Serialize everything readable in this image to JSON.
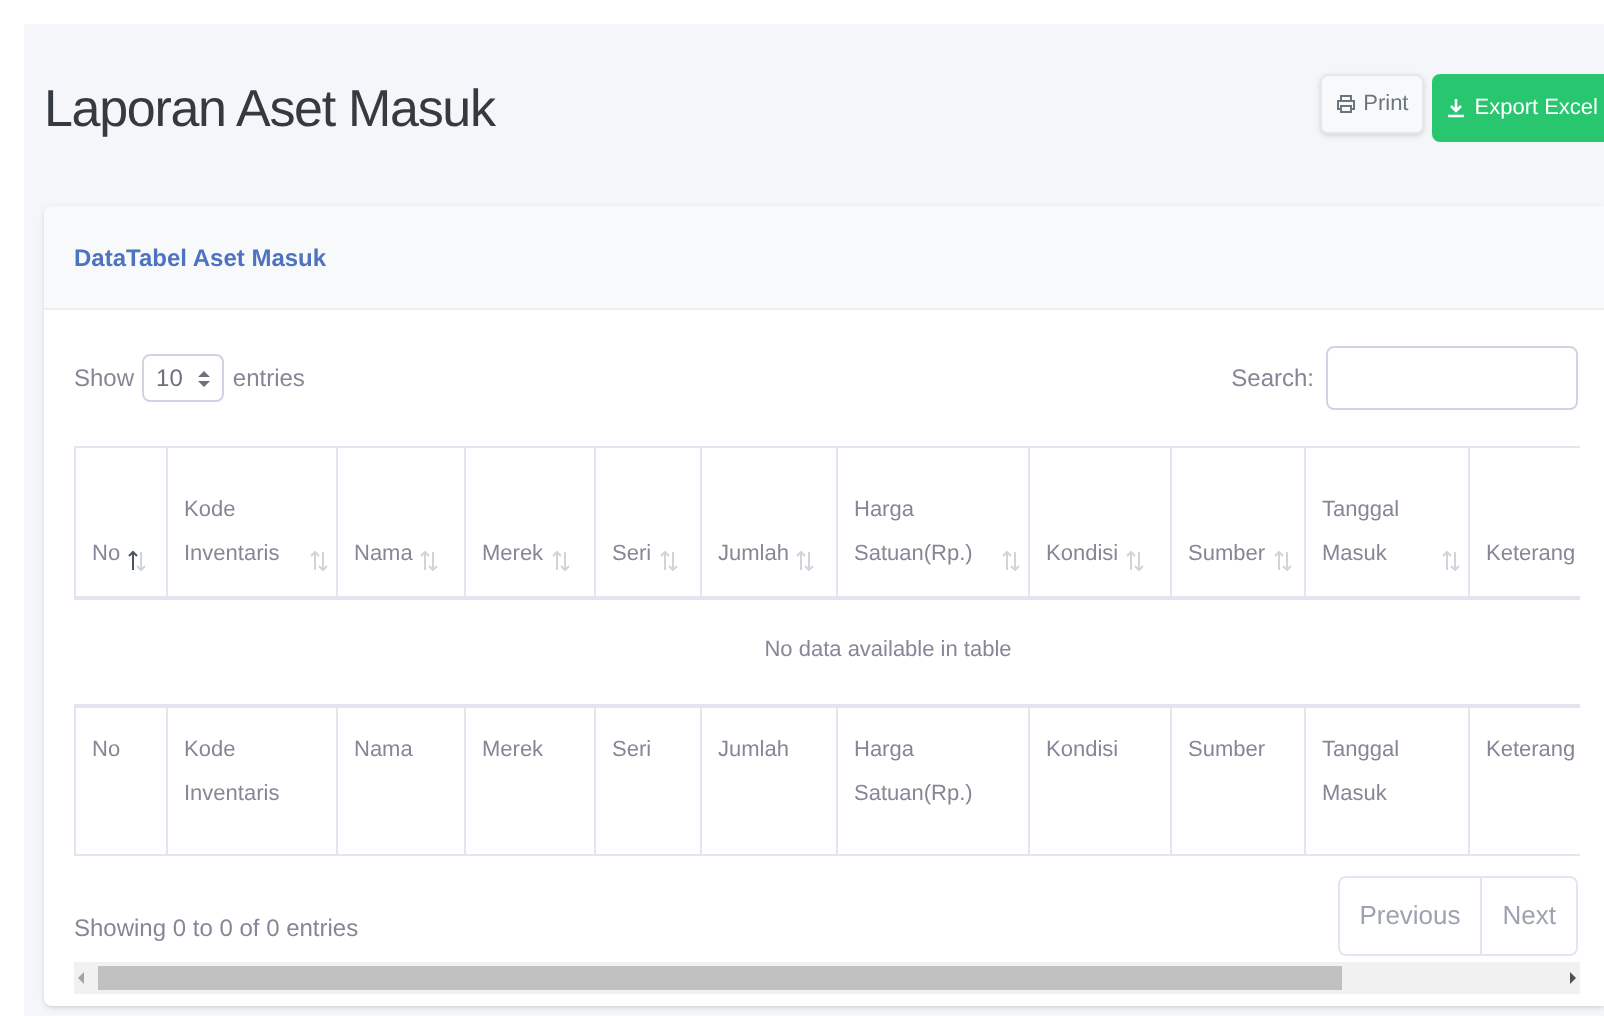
{
  "page": {
    "title": "Laporan Aset Masuk"
  },
  "actions": [
    {
      "kind": "print",
      "label": "Print"
    },
    {
      "kind": "export",
      "label": "Export Excel"
    }
  ],
  "card": {
    "title": "DataTabel Aset Masuk"
  },
  "length_control": {
    "before": "Show",
    "value": "10",
    "after": "entries"
  },
  "search": {
    "label": "Search:"
  },
  "table": {
    "columns": [
      {
        "label": "No",
        "sorted": true
      },
      {
        "label": "Kode Inventaris",
        "sorted": false
      },
      {
        "label": "Nama",
        "sorted": false
      },
      {
        "label": "Merek",
        "sorted": false
      },
      {
        "label": "Seri",
        "sorted": false
      },
      {
        "label": "Jumlah",
        "sorted": false
      },
      {
        "label": "Harga Satuan(Rp.)",
        "sorted": false
      },
      {
        "label": "Kondisi",
        "sorted": false
      },
      {
        "label": "Sumber",
        "sorted": false
      },
      {
        "label": "Tanggal Masuk",
        "sorted": false
      },
      {
        "label": "Keterang"
      }
    ],
    "empty_message": "No data available in table",
    "footer_columns": [
      "No",
      "Kode Inventaris",
      "Nama",
      "Merek",
      "Seri",
      "Jumlah",
      "Harga Satuan(Rp.)",
      "Kondisi",
      "Sumber",
      "Tanggal Masuk",
      "Keterang"
    ]
  },
  "info": "Showing 0 to 0 of 0 entries",
  "pagination": [
    {
      "label": "Previous",
      "disabled": true
    },
    {
      "label": "Next",
      "disabled": true
    }
  ]
}
